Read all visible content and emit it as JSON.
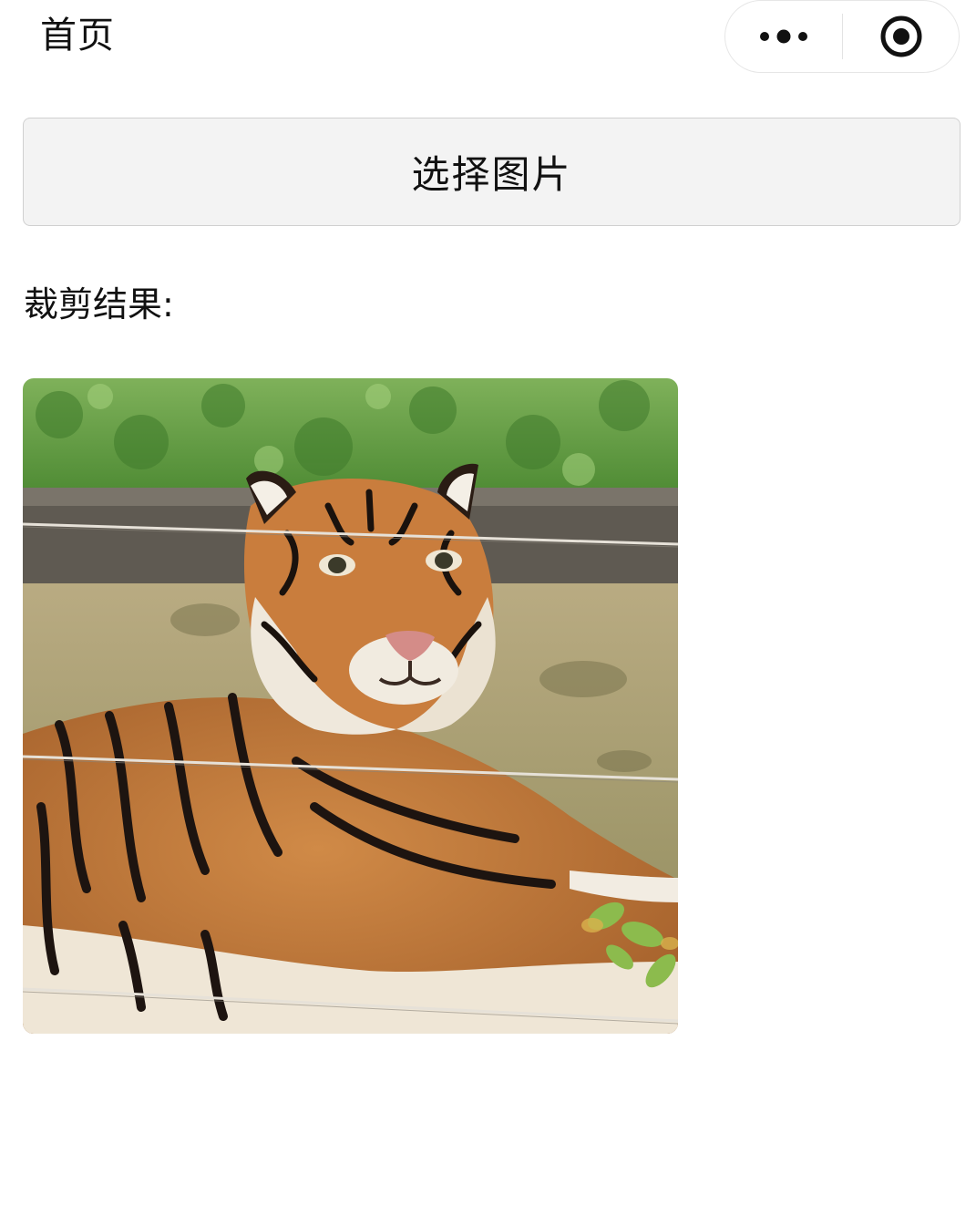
{
  "nav": {
    "title": "首页",
    "more_icon": "more-dots-icon",
    "close_icon": "target-circle-icon"
  },
  "actions": {
    "choose_image_label": "选择图片"
  },
  "result": {
    "label": "裁剪结果:",
    "image_subject": "tiger-photo"
  }
}
